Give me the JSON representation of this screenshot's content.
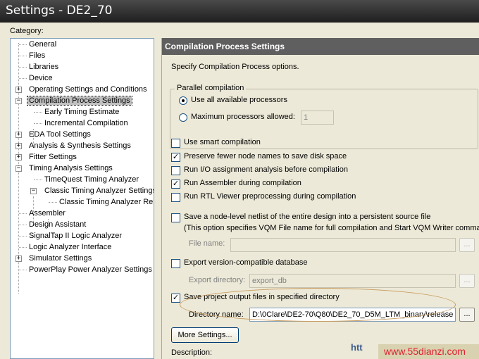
{
  "window": {
    "title": "Settings - DE2_70"
  },
  "category_label": "Category:",
  "tree": {
    "general": "General",
    "files": "Files",
    "libraries": "Libraries",
    "device": "Device",
    "operating": "Operating Settings and Conditions",
    "compilation": "Compilation Process Settings",
    "early_timing": "Early Timing Estimate",
    "incremental": "Incremental Compilation",
    "eda": "EDA Tool Settings",
    "analysis": "Analysis & Synthesis Settings",
    "fitter": "Fitter Settings",
    "timing_analysis": "Timing Analysis Settings",
    "timequest": "TimeQuest Timing Analyzer",
    "classic": "Classic Timing Analyzer Settings",
    "classic_reports": "Classic Timing Analyzer Repo",
    "assembler": "Assembler",
    "design_assistant": "Design Assistant",
    "signaltap": "SignalTap II Logic Analyzer",
    "logic_interface": "Logic Analyzer Interface",
    "simulator": "Simulator Settings",
    "powerplay": "PowerPlay Power Analyzer Settings",
    "expander_plus": "+",
    "expander_minus": "−"
  },
  "panel": {
    "header": "Compilation Process Settings",
    "description": "Specify Compilation Process options.",
    "parallel": {
      "legend": "Parallel compilation",
      "option_all": "Use all available processors",
      "option_max": "Maximum processors allowed:",
      "max_value": "1"
    },
    "options": {
      "smart": "Use smart compilation",
      "preserve": "Preserve fewer node names to save disk space",
      "io": "Run I/O assignment analysis before compilation",
      "assembler": "Run Assembler during compilation",
      "rtl": "Run RTL Viewer preprocessing during compilation"
    },
    "netlist": {
      "label": "Save a node-level netlist of the entire design into a persistent source file",
      "note": "(This option specifies VQM File name for full compilation and Start VQM Writer command)",
      "file_label": "File name:",
      "file_value": ""
    },
    "export": {
      "label": "Export version-compatible database",
      "dir_label": "Export directory:",
      "dir_value": "export_db"
    },
    "save_output": {
      "label": "Save project output files in specified directory",
      "dir_label": "Directory name:",
      "dir_value": "D:\\0Clare\\DE2-70\\Q80\\DE2_70_D5M_LTM_binary\\release"
    },
    "more_settings": "More Settings...",
    "description_label": "Description:",
    "browse": "..."
  },
  "checked": "✓",
  "watermark": {
    "partial": "htt",
    "site": "www.55dianzi.com"
  },
  "colors": {
    "header_bg": "#5f5f5f",
    "dialog_bg": "#ece9d8",
    "selection": "#c0c0c0",
    "watermark_red": "#e0202e"
  }
}
